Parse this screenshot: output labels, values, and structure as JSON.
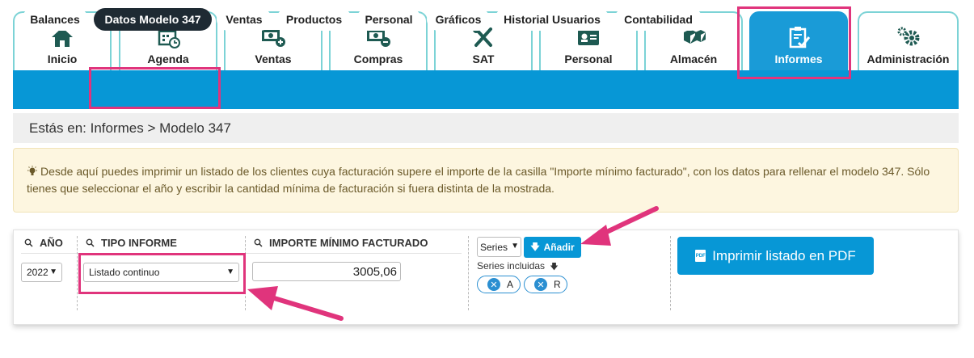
{
  "tabs": [
    {
      "label": "Inicio",
      "icon": "home-icon"
    },
    {
      "label": "Agenda",
      "icon": "calendar-icon"
    },
    {
      "label": "Ventas",
      "icon": "money-plus-icon"
    },
    {
      "label": "Compras",
      "icon": "money-minus-icon"
    },
    {
      "label": "SAT",
      "icon": "tools-icon"
    },
    {
      "label": "Personal",
      "icon": "id-card-icon"
    },
    {
      "label": "Almacén",
      "icon": "boxes-icon"
    },
    {
      "label": "Informes",
      "icon": "clipboard-check-icon"
    },
    {
      "label": "Administración",
      "icon": "gears-icon"
    }
  ],
  "subnav": [
    "Balances",
    "Datos Modelo 347",
    "Ventas",
    "Productos",
    "Personal",
    "Gráficos",
    "Historial Usuarios",
    "Contabilidad"
  ],
  "breadcrumb": "Estás en: Informes > Modelo 347",
  "info_text": "Desde aquí puedes imprimir un listado de los clientes cuya facturación supere el importe de la casilla \"Importe mínimo facturado\", con los datos para rellenar el modelo 347. Sólo tienes que seleccionar el año y escribir la cantidad mínima de facturación si fuera distinta de la mostrada.",
  "form": {
    "year_label": "AÑO",
    "year_value": "2022",
    "type_label": "TIPO INFORME",
    "type_value": "Listado continuo",
    "amount_label": "IMPORTE MÍNIMO FACTURADO",
    "amount_value": "3005,06",
    "series_select": "Series",
    "add_button": "Añadir",
    "series_included": "Series incluidas",
    "chips": [
      "A",
      "R"
    ],
    "pdf_button": "Imprimir listado en PDF"
  },
  "colors": {
    "accent": "#0797d6",
    "highlight": "#e0347c",
    "tab_border": "#7cd3d6"
  }
}
